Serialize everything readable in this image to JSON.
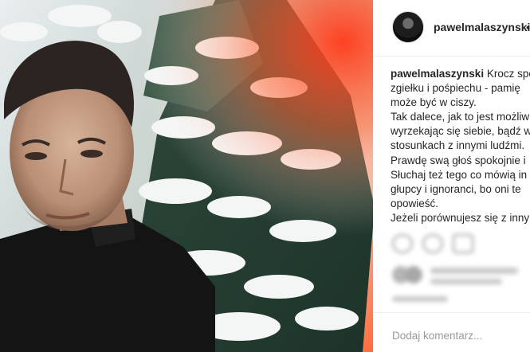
{
  "post": {
    "username": "pawelmalaszynski",
    "header_dot": "•",
    "caption_lines": [
      "Krocz spo",
      "zgiełku i pośpiechu - pamię",
      "może być w ciszy.",
      "Tak dalece, jak to jest możliw",
      "wyrzekając się siebie, bądź w",
      "stosunkach z innymi ludźmi.",
      "Prawdę swą głoś spokojnie i",
      "Słuchaj też tego co mówią in",
      "głupcy i ignoranci, bo oni te",
      "opowieść.",
      "Jeżeli porównujesz się z inny"
    ],
    "comment_placeholder": "Dodaj komentarz...",
    "comment_more": "•••"
  },
  "colors": {
    "text": "#262626",
    "muted": "#999999",
    "border": "#efefef",
    "photo_flare": "#ff6a3a"
  },
  "icons": [
    "profile-avatar",
    "like-icon",
    "comment-icon",
    "share-icon"
  ]
}
